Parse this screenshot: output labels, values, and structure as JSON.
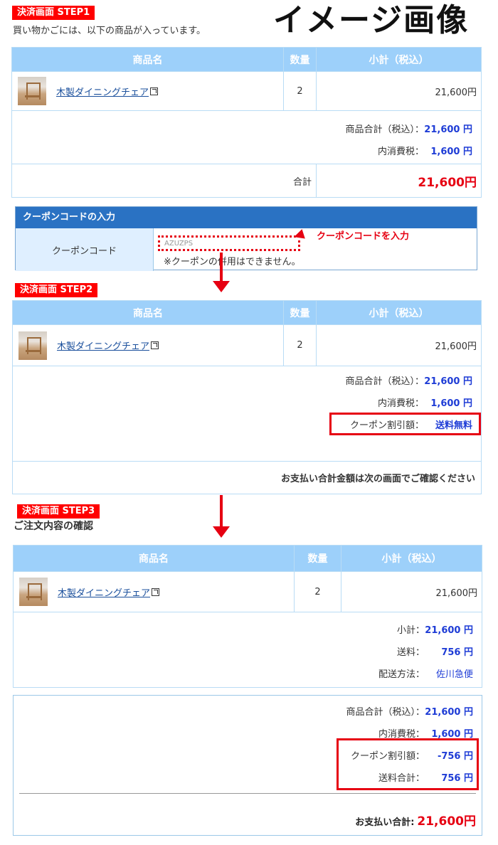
{
  "image_title": "イメージ画像",
  "step1": {
    "badge": "決済画面 STEP1",
    "intro": "買い物かごには、以下の商品が入っています。",
    "headers": [
      "商品名",
      "数量",
      "小計（税込）"
    ],
    "item": {
      "name": "木製ダイニングチェア",
      "qty": "2",
      "price": "21,600円"
    },
    "summary": [
      {
        "label": "商品合計（税込）：",
        "value": "21,600 円"
      },
      {
        "label": "内消費税：",
        "value": "1,600 円"
      }
    ],
    "total_label": "合計",
    "total_value": "21,600円"
  },
  "coupon": {
    "header": "クーポンコードの入力",
    "label": "クーポンコード",
    "input_value": "AZUZPS",
    "note": "※クーポンの併用はできません。",
    "annotation": "クーポンコードを入力"
  },
  "step2": {
    "badge": "決済画面 STEP2",
    "headers": [
      "商品名",
      "数量",
      "小計（税込）"
    ],
    "item": {
      "name": "木製ダイニングチェア",
      "qty": "2",
      "price": "21,600円"
    },
    "summary": [
      {
        "label": "商品合計（税込）：",
        "value": "21,600 円"
      },
      {
        "label": "内消費税：",
        "value": "1,600 円"
      },
      {
        "label": "クーポン割引額：",
        "value": "送料無料"
      }
    ],
    "footer": "お支払い合計金額は次の画面でご確認ください"
  },
  "step3": {
    "badge": "決済画面 STEP3",
    "subtitle": "ご注文内容の確認",
    "headers": [
      "商品名",
      "数量",
      "小計（税込）"
    ],
    "item": {
      "name": "木製ダイニングチェア",
      "qty": "2",
      "price": "21,600円"
    },
    "summary": [
      {
        "label": "小計：",
        "value": "21,600 円"
      },
      {
        "label": "送料：",
        "value": "756 円"
      },
      {
        "label": "配送方法：",
        "value": "佐川急便"
      }
    ],
    "totals": [
      {
        "label": "商品合計（税込）：",
        "value": "21,600 円"
      },
      {
        "label": "内消費税：",
        "value": "1,600 円"
      },
      {
        "label": "クーポン割引額：",
        "value": "-756 円"
      },
      {
        "label": "送料合計：",
        "value": "756 円"
      }
    ],
    "grand_label": "お支払い合計:",
    "grand_value": "21,600円"
  },
  "colors": {
    "accent_red": "#e60012",
    "header_blue": "#9dd0fa",
    "value_blue": "#1e3cd6",
    "coupon_head": "#2a72c3"
  },
  "icons": [
    "external-link-icon",
    "down-arrow-icon",
    "left-arrow-icon"
  ]
}
